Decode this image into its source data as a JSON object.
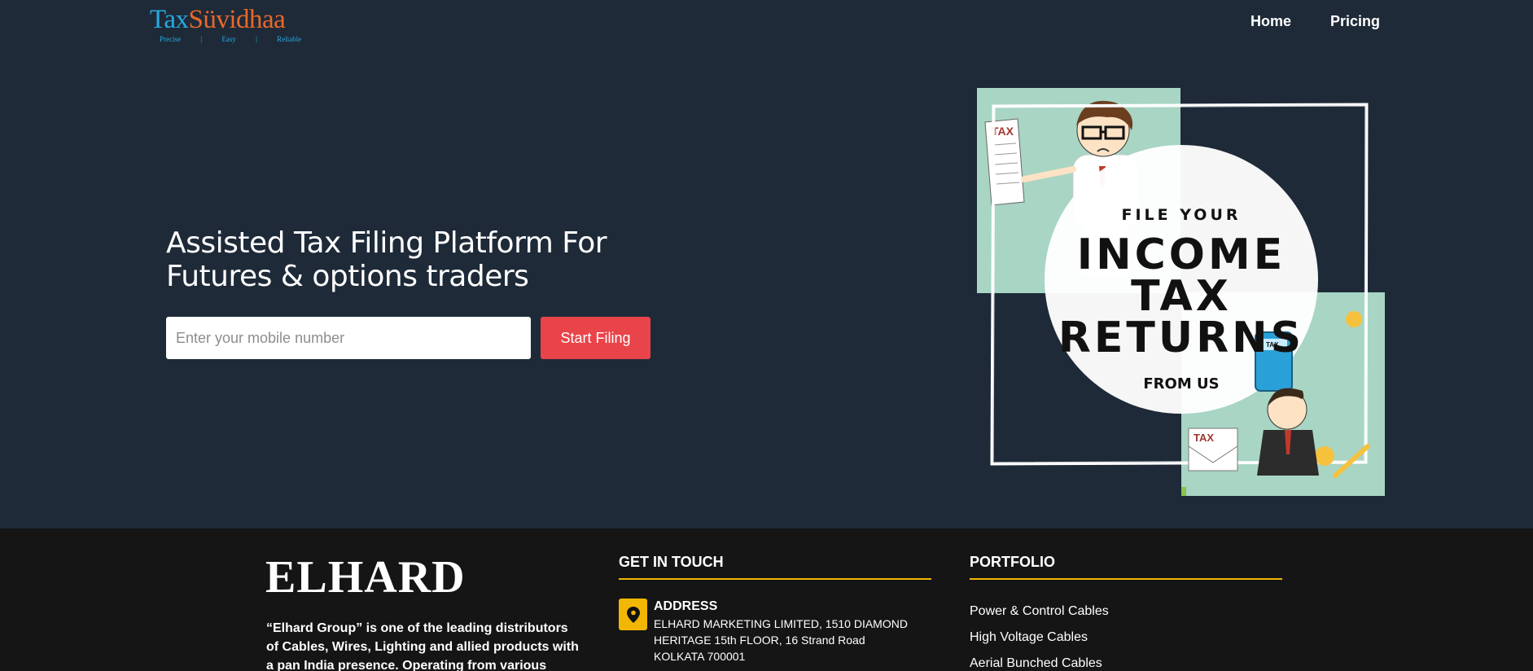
{
  "header": {
    "logo": {
      "part1": "Tax",
      "part2": "Süvidhaa",
      "taglines": [
        "Precise",
        "|",
        "Easy",
        "|",
        "Reliable"
      ]
    },
    "nav": [
      {
        "label": "Home"
      },
      {
        "label": "Pricing"
      }
    ]
  },
  "hero": {
    "title": "Assisted Tax Filing Platform For Futures & options traders",
    "input_placeholder": "Enter your mobile number",
    "button_label": "Start Filing"
  },
  "illustration": {
    "line1": "FILE YOUR",
    "line2": "INCOME",
    "line3": "TAX",
    "line4": "RETURNS",
    "line5": "FROM US",
    "tax_tag": "TAX"
  },
  "footer": {
    "brand": "ELHARD",
    "about": "“Elhard Group” is one of the leading distributors of Cables, Wires, Lighting and allied products with a pan India presence. Operating from various locations in",
    "contact_heading": "GET IN TOUCH",
    "address_label": "ADDRESS",
    "address_text": "ELHARD MARKETING LIMITED, 1510 DIAMOND HERITAGE 15th FLOOR, 16 Strand Road KOLKATA 700001",
    "portfolio_heading": "PORTFOLIO",
    "portfolio_items": [
      "Power & Control Cables",
      "High Voltage Cables",
      "Aerial Bunched Cables"
    ]
  },
  "colors": {
    "background": "#1e2a38",
    "accent_red": "#e9444a",
    "footer_bg": "#151515",
    "footer_accent": "#f2b705"
  }
}
